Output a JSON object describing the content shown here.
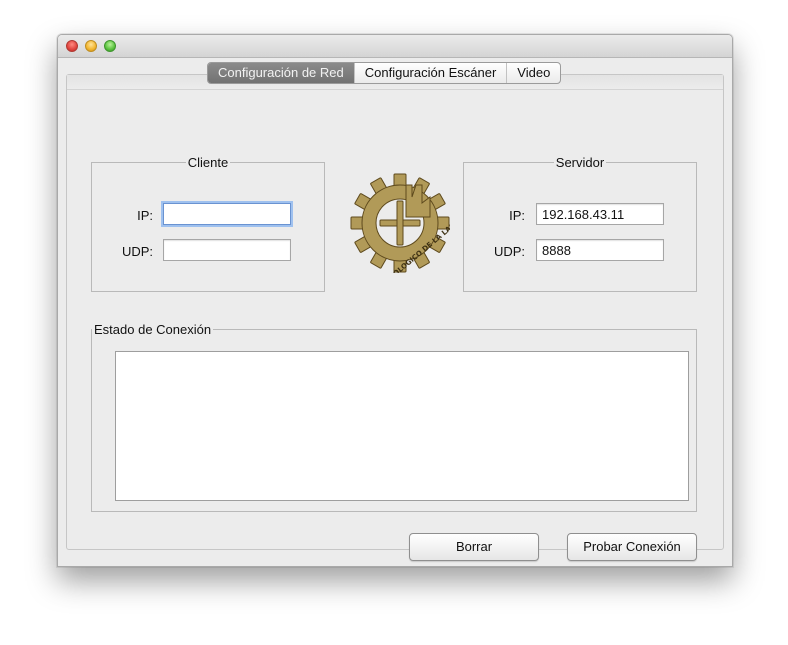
{
  "window": {
    "traffic_lights": [
      "close",
      "minimize",
      "maximize"
    ]
  },
  "tabs": [
    {
      "label": "Configuración de Red",
      "active": true
    },
    {
      "label": "Configuración Escáner",
      "active": false
    },
    {
      "label": "Video",
      "active": false
    }
  ],
  "cliente": {
    "title": "Cliente",
    "ip_label": "IP:",
    "ip_value": "",
    "udp_label": "UDP:",
    "udp_value": ""
  },
  "servidor": {
    "title": "Servidor",
    "ip_label": "IP:",
    "ip_value": "192.168.43.11",
    "udp_label": "UDP:",
    "udp_value": "8888"
  },
  "logo": {
    "icon": "gear-factory-logo",
    "text": "TECNOLOGICO DE LA LAGUNA",
    "color": "#b19a58"
  },
  "estado": {
    "title": "Estado de Conexión",
    "log": ""
  },
  "buttons": {
    "borrar": "Borrar",
    "probar": "Probar Conexión"
  }
}
